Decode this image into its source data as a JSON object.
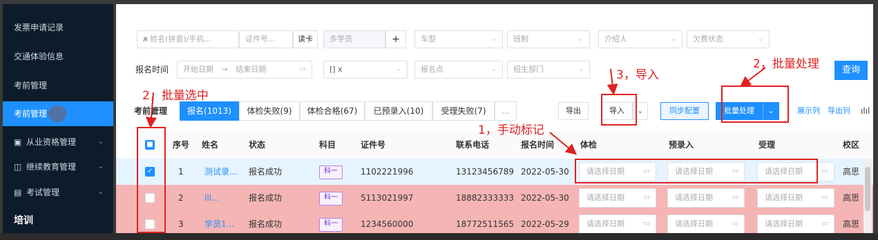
{
  "sidebar": {
    "items": [
      {
        "label": "发票申请记录"
      },
      {
        "label": "交通体验信息"
      },
      {
        "label": "考前管理"
      },
      {
        "label": "考前管理"
      },
      {
        "label": "从业资格管理"
      },
      {
        "label": "继续教育管理"
      },
      {
        "label": "考试管理"
      },
      {
        "label": "培训"
      }
    ]
  },
  "filters": {
    "name_phone": "姓名(拼音)/手机...",
    "id_no": "证件号...",
    "read_card": "读卡",
    "multi_student": "多学员",
    "plus": "+",
    "car_type": "车型",
    "class": "班制",
    "referrer": "介绍人",
    "arrears": "欠费状态",
    "reg_time_label": "报名时间",
    "start_date": "开始日期",
    "arrow": "→",
    "end_date": "结束日期",
    "tag_select": "[] x",
    "reg_point": "报名点",
    "recruit_dept": "招生部门",
    "query": "查询"
  },
  "toolbar": {
    "section_label": "考前管理",
    "tabs": [
      "报名(1013)",
      "体检失败(9)",
      "体检合格(67)",
      "已预录入(10)",
      "受理失败(7)",
      "..."
    ],
    "export": "导出",
    "import": "导入",
    "sync": "同步配置",
    "batch": "批量处理",
    "display_cols": "展示列",
    "export_cols": "导出列"
  },
  "table": {
    "headers": [
      "序号",
      "姓名",
      "状态",
      "科目",
      "证件号",
      "联系电话",
      "报名时间",
      "体检",
      "预录入",
      "受理",
      "校区"
    ],
    "date_placeholder": "请选择日期",
    "rows": [
      {
        "no": "1",
        "name": "测试录...",
        "status": "报名成功",
        "subject": "科一",
        "id": "1102221996",
        "phone": "13123456789",
        "time": "2022-05-30",
        "campus": "高思",
        "checked": true
      },
      {
        "no": "2",
        "name": "lll...",
        "status": "报名成功",
        "subject": "科一",
        "id": "5113021997",
        "phone": "18882333333",
        "time": "2022-05-30",
        "campus": "高思",
        "checked": false
      },
      {
        "no": "3",
        "name": "学员1...",
        "status": "报名成功",
        "subject": "科一",
        "id": "1234560000",
        "phone": "18772511565",
        "time": "2022-05-29",
        "campus": "高思",
        "checked": false
      }
    ]
  },
  "annotations": {
    "batch_select": "2，批量选中",
    "manual_mark": "1，手动标记",
    "import": "3，导入",
    "batch_process": "2，批量处理"
  },
  "colors": {
    "accent": "#1e90ff",
    "sidebar": "#0d1b2a",
    "annotation": "#e02020",
    "row_selected": "#e6f4ff",
    "row_pink": "#f5b5b5"
  }
}
